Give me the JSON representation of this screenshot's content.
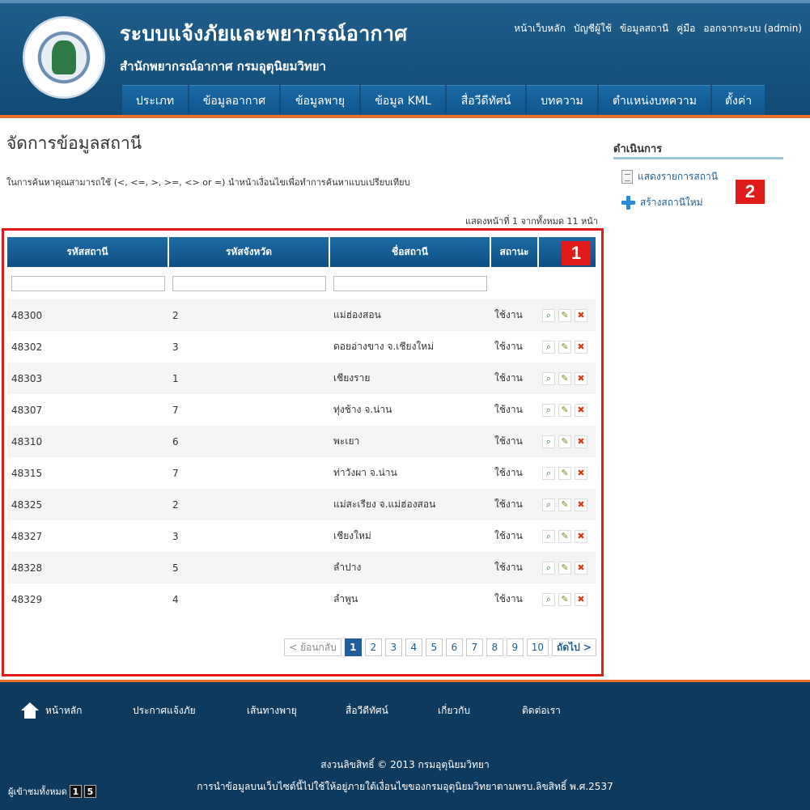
{
  "header": {
    "title": "ระบบแจ้งภัยและพยากรณ์อากาศ",
    "subtitle": "สำนักพยากรณ์อากาศ กรมอุตุนิยมวิทยา",
    "top_links": [
      "หน้าเว็บหลัก",
      "บัญชีผู้ใช้",
      "ข้อมูลสถานี",
      "คู่มือ",
      "ออกจากระบบ (admin)"
    ],
    "nav": [
      "ประเภท",
      "ข้อมูลอากาศ",
      "ข้อมูลพายุ",
      "ข้อมูล KML",
      "สื่อวีดีทัศน์",
      "บทความ",
      "ตำแหน่งบทความ",
      "ตั้งค่า"
    ],
    "brand_color": "#124a75",
    "accent_color": "#e8702a"
  },
  "main": {
    "page_title": "จัดการข้อมูลสถานี",
    "hint": "ในการค้นหาคุณสามารถใช้ (<, <=, >, >=, <> or =) นำหน้าเงื่อนไขเพื่อทำการค้นหาแบบเปรียบเทียบ",
    "pager_summary": "แสดงหน้าที่ 1 จากทั้งหมด 11 หน้า",
    "badge_table": "1",
    "columns": [
      "รหัสสถานี",
      "รหัสจังหวัด",
      "ชื่อสถานี",
      "สถานะ"
    ],
    "rows": [
      {
        "id": "48300",
        "province": "2",
        "name": "แม่ฮ่องสอน",
        "status": "ใช้งาน"
      },
      {
        "id": "48302",
        "province": "3",
        "name": "ดอยอ่างขาง จ.เชียงใหม่",
        "status": "ใช้งาน"
      },
      {
        "id": "48303",
        "province": "1",
        "name": "เชียงราย",
        "status": "ใช้งาน"
      },
      {
        "id": "48307",
        "province": "7",
        "name": "ทุ่งช้าง จ.น่าน",
        "status": "ใช้งาน"
      },
      {
        "id": "48310",
        "province": "6",
        "name": "พะเยา",
        "status": "ใช้งาน"
      },
      {
        "id": "48315",
        "province": "7",
        "name": "ท่าวังผา จ.น่าน",
        "status": "ใช้งาน"
      },
      {
        "id": "48325",
        "province": "2",
        "name": "แม่สะเรียง จ.แม่ฮ่องสอน",
        "status": "ใช้งาน"
      },
      {
        "id": "48327",
        "province": "3",
        "name": "เชียงใหม่",
        "status": "ใช้งาน"
      },
      {
        "id": "48328",
        "province": "5",
        "name": "ลำปาง",
        "status": "ใช้งาน"
      },
      {
        "id": "48329",
        "province": "4",
        "name": "ลำพูน",
        "status": "ใช้งาน"
      }
    ],
    "row_action_icons": [
      "view-icon",
      "edit-icon",
      "delete-icon"
    ],
    "pager": {
      "prev": "< ย้อนกลับ",
      "pages": [
        "1",
        "2",
        "3",
        "4",
        "5",
        "6",
        "7",
        "8",
        "9",
        "10"
      ],
      "current": "1",
      "next": "ถัดไป >"
    }
  },
  "sidebar": {
    "title": "ดำเนินการ",
    "badge": "2",
    "items": [
      {
        "label": "แสดงรายการสถานี",
        "icon": "document-list-icon"
      },
      {
        "label": "สร้างสถานีใหม่",
        "icon": "plus-icon"
      }
    ]
  },
  "footer": {
    "nav": [
      "หน้าหลัก",
      "ประกาศแจ้งภัย",
      "เส้นทางพายุ",
      "สื่อวีดีทัศน์",
      "เกี่ยวกับ",
      "ติดต่อเรา"
    ],
    "copyright": "สงวนลิขสิทธิ์ © 2013 กรมอุตุนิยมวิทยา",
    "notice": "การนำข้อมูลบนเว็บไซต์นี้ไปใช้ให้อยู่ภายใต้เงื่อนไขของกรมอุตุนิยมวิทยาตามพรบ.ลิขสิทธิ์ พ.ศ.2537",
    "visitors_label": "ผู้เข้าชมทั้งหมด",
    "visitor_digits": [
      "1",
      "5"
    ]
  }
}
